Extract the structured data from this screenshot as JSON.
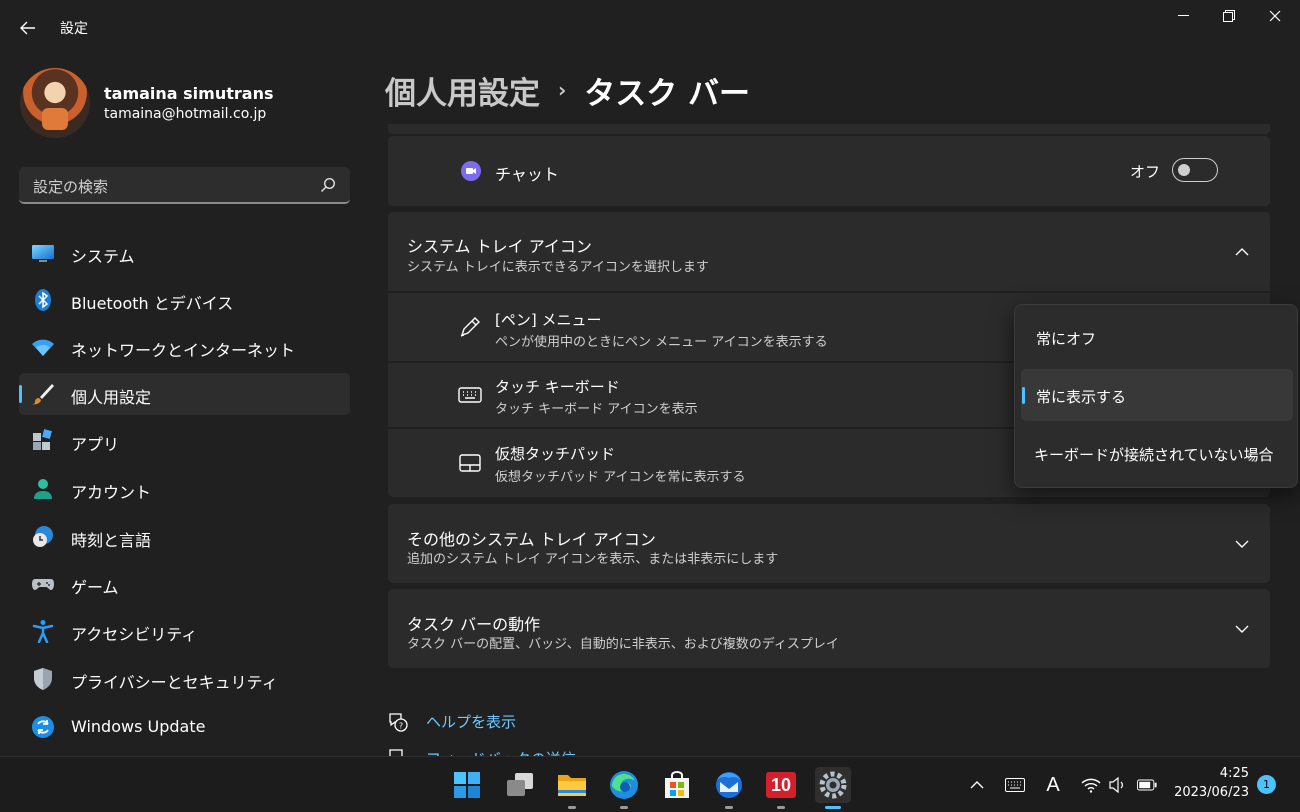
{
  "window": {
    "title": "設定",
    "back_icon": "back-arrow-icon",
    "controls": [
      "minimize-icon",
      "restore-icon",
      "close-icon"
    ]
  },
  "profile": {
    "name": "tamaina simutrans",
    "email": "tamaina@hotmail.co.jp"
  },
  "search": {
    "placeholder": "設定の検索"
  },
  "nav": {
    "items": [
      {
        "label": "システム",
        "icon": "system-icon"
      },
      {
        "label": "Bluetooth とデバイス",
        "icon": "bluetooth-icon"
      },
      {
        "label": "ネットワークとインターネット",
        "icon": "wifi-icon"
      },
      {
        "label": "個人用設定",
        "icon": "brush-icon",
        "active": true
      },
      {
        "label": "アプリ",
        "icon": "apps-icon"
      },
      {
        "label": "アカウント",
        "icon": "account-icon"
      },
      {
        "label": "時刻と言語",
        "icon": "time-language-icon"
      },
      {
        "label": "ゲーム",
        "icon": "gamepad-icon"
      },
      {
        "label": "アクセシビリティ",
        "icon": "accessibility-icon"
      },
      {
        "label": "プライバシーとセキュリティ",
        "icon": "shield-icon"
      },
      {
        "label": "Windows Update",
        "icon": "windows-update-icon"
      }
    ]
  },
  "breadcrumb": {
    "parent": "個人用設定",
    "separator": "›",
    "current": "タスク バー"
  },
  "chat": {
    "label": "チャット",
    "state": "オフ",
    "enabled": false
  },
  "tray_section": {
    "title": "システム トレイ アイコン",
    "subtitle": "システム トレイに表示できるアイコンを選択します",
    "expanded": true,
    "items": [
      {
        "title": "[ペン] メニュー",
        "subtitle": "ペンが使用中のときにペン メニュー アイコンを表示する",
        "icon": "pen-icon"
      },
      {
        "title": "タッチ キーボード",
        "subtitle": "タッチ キーボード アイコンを表示",
        "icon": "keyboard-icon"
      },
      {
        "title": "仮想タッチパッド",
        "subtitle": "仮想タッチパッド アイコンを常に表示する",
        "icon": "touchpad-icon"
      }
    ]
  },
  "dropdown": {
    "options": [
      "常にオフ",
      "常に表示する",
      "キーボードが接続されていない場合"
    ],
    "selected": "常に表示する"
  },
  "other_tray": {
    "title": "その他のシステム トレイ アイコン",
    "subtitle": "追加のシステム トレイ アイコンを表示、または非表示にします"
  },
  "behavior": {
    "title": "タスク バーの動作",
    "subtitle": "タスク バーの配置、バッジ、自動的に非表示、および複数のディスプレイ"
  },
  "links": {
    "help": "ヘルプを表示",
    "feedback": "フィードバックの送信"
  },
  "taskbar": {
    "apps": [
      "start-icon",
      "task-view-icon",
      "file-explorer-icon",
      "edge-icon",
      "store-icon",
      "thunderbird-icon",
      "app-10-icon",
      "settings-icon"
    ],
    "tray": [
      "chevron-up-icon",
      "keyboard-icon",
      "ime-icon",
      "wifi-icon",
      "volume-icon",
      "battery-icon"
    ],
    "ime_label": "A",
    "app10_label": "10",
    "time": "4:25",
    "date": "2023/06/23",
    "notifications": "1"
  },
  "colors": {
    "accent": "#4cc2ff",
    "background": "#202020",
    "card": "#2b2b2b"
  }
}
